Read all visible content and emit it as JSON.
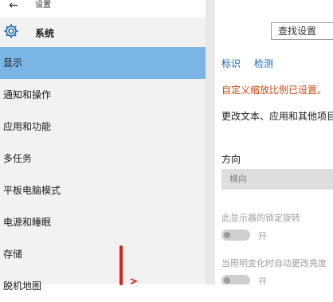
{
  "app": {
    "title": "设置",
    "back_glyph": "←"
  },
  "header": {
    "section_title": "系统"
  },
  "search": {
    "placeholder": "查找设置"
  },
  "nav": {
    "items": [
      {
        "label": "显示",
        "selected": true
      },
      {
        "label": "通知和操作",
        "selected": false
      },
      {
        "label": "应用和功能",
        "selected": false
      },
      {
        "label": "多任务",
        "selected": false
      },
      {
        "label": "平板电脑模式",
        "selected": false
      },
      {
        "label": "电源和睡眠",
        "selected": false
      },
      {
        "label": "存储",
        "selected": false
      },
      {
        "label": "脱机地图",
        "selected": false
      }
    ]
  },
  "display": {
    "identify_link": "标识",
    "detect_link": "检测",
    "custom_scaling_notice": "自定义缩放比例已设置。",
    "change_size_text": "更改文本、应用和其他项目",
    "orientation_label": "方向",
    "orientation_value": "横向",
    "rotation_lock_label": "此显示器的锁定旋转",
    "rotation_lock_state": "开",
    "auto_brightness_label": "当照明变化时自动更改亮度",
    "auto_brightness_state": "开"
  },
  "colors": {
    "accent_selected": "#7ab5e6",
    "link": "#1066b8",
    "warning": "#c94a10",
    "annotation_red": "#d6241c"
  },
  "icons": {
    "gear": "gear-icon",
    "back": "back-arrow-icon"
  }
}
